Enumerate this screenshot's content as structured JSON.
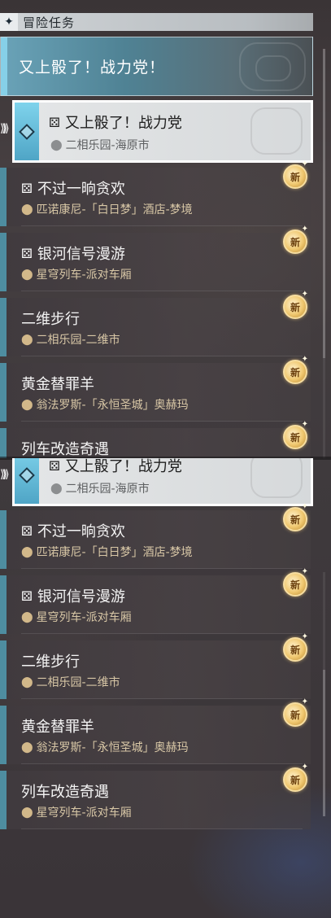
{
  "header": {
    "title": "冒险任务",
    "icon": "sparkle-diamond-icon"
  },
  "featured": {
    "title": "又上骰了！战力党！"
  },
  "selected_quest": {
    "name": "又上骰了！战力党",
    "location": "二相乐园-海原市",
    "type_icon": "dice-icon"
  },
  "quests": [
    {
      "name": "不过一晌贪欢",
      "location": "匹诺康尼-「白日梦」酒店-梦境",
      "has_type_icon": true,
      "badge": "新"
    },
    {
      "name": "银河信号漫游",
      "location": "星穹列车-派对车厢",
      "has_type_icon": true,
      "badge": "新"
    },
    {
      "name": "二维步行",
      "location": "二相乐园-二维市",
      "has_type_icon": false,
      "badge": "新"
    },
    {
      "name": "黄金替罪羊",
      "location": "翁法罗斯-「永恒圣城」奥赫玛",
      "has_type_icon": false,
      "badge": "新"
    },
    {
      "name": "列车改造奇遇",
      "location": "星穹列车-派对车厢",
      "has_type_icon": false,
      "badge": "新"
    }
  ],
  "colors": {
    "accent_teal": "#4e8da0",
    "selected_bg": "#e4e6e7",
    "badge_gold": "#f0c870",
    "location_text": "#d8c7a6"
  }
}
